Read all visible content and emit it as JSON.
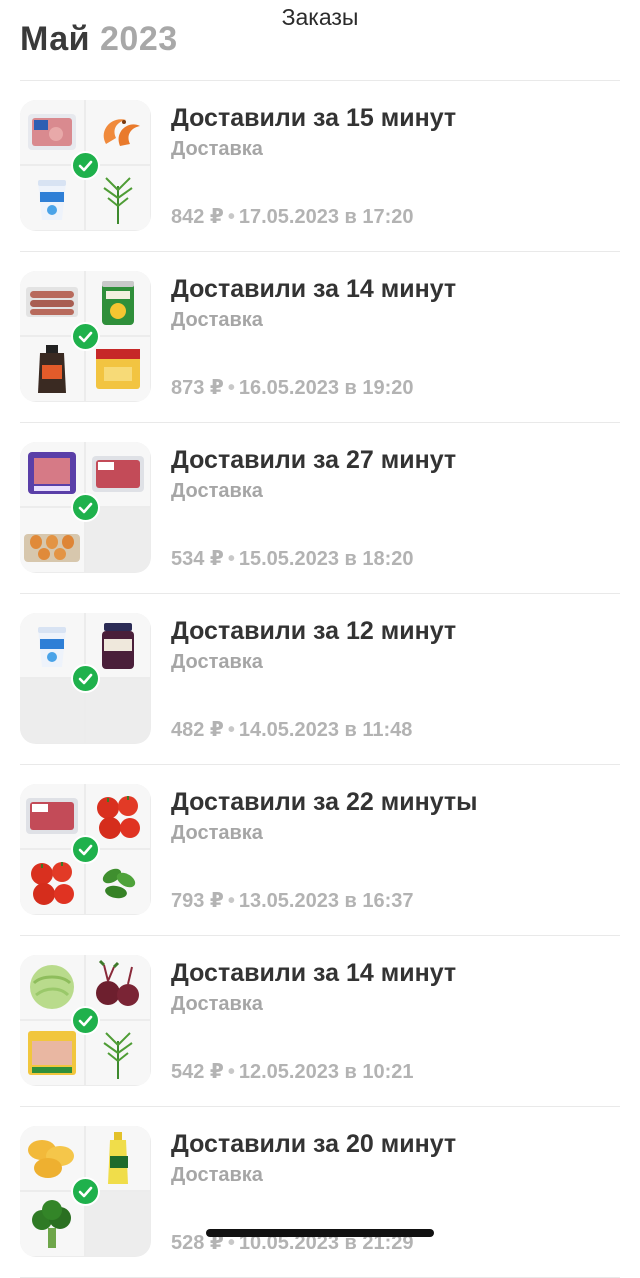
{
  "screen_title": "Заказы",
  "section": {
    "month": "Май",
    "year": "2023"
  },
  "orders": [
    {
      "title": "Доставили за 15 минут",
      "type": "Доставка",
      "price": "842 ₽",
      "datetime": "17.05.2023 в 17:20",
      "items": [
        "packaged-meat",
        "shrimp",
        "yogurt-cup",
        "dill"
      ]
    },
    {
      "title": "Доставили за 14 минут",
      "type": "Доставка",
      "price": "873 ₽",
      "datetime": "16.05.2023 в 19:20",
      "items": [
        "sausages",
        "canned-corn",
        "sauce-bottle",
        "cheese-slices"
      ]
    },
    {
      "title": "Доставили за 27 минут",
      "type": "Доставка",
      "price": "534 ₽",
      "datetime": "15.05.2023 в 18:20",
      "items": [
        "packaged-minced-meat",
        "minced-meat-tray",
        "eggs",
        "empty"
      ]
    },
    {
      "title": "Доставили за 12 минут",
      "type": "Доставка",
      "price": "482 ₽",
      "datetime": "14.05.2023 в 11:48",
      "items": [
        "yogurt-cup",
        "jam-jar",
        "empty",
        "empty"
      ]
    },
    {
      "title": "Доставили за 22 минуты",
      "type": "Доставка",
      "price": "793 ₽",
      "datetime": "13.05.2023 в 16:37",
      "items": [
        "minced-meat-tray",
        "tomatoes",
        "tomatoes",
        "basil"
      ]
    },
    {
      "title": "Доставили за 14 минут",
      "type": "Доставка",
      "price": "542 ₽",
      "datetime": "12.05.2023 в 10:21",
      "items": [
        "cabbage",
        "beets",
        "chicken-pack",
        "dill"
      ]
    },
    {
      "title": "Доставили за 20 минут",
      "type": "Доставка",
      "price": "528 ₽",
      "datetime": "10.05.2023 в 21:29",
      "items": [
        "chips",
        "oil-bottle",
        "broccoli",
        "empty"
      ]
    }
  ],
  "separator": "•",
  "colors": {
    "check": "#1fb14c",
    "muted": "#a6a6a6",
    "title": "#333333"
  }
}
